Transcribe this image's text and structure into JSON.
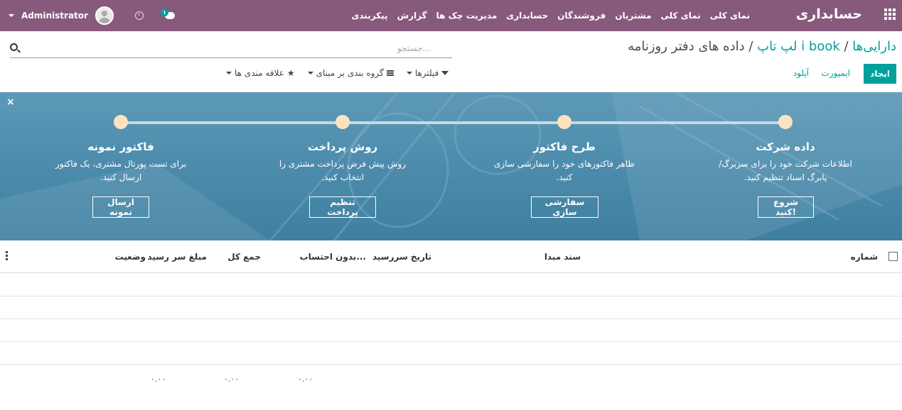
{
  "navbar": {
    "brand": "حسابداری",
    "menu": [
      "نمای کلی",
      "نمای کلی",
      "مشتریان",
      "فروشندگان",
      "حسابداری",
      "مدیریت چک ها",
      "گزارش",
      "پیکربندی"
    ],
    "user": "Administrator",
    "chat_badge": "۱"
  },
  "breadcrumb": {
    "item1": "دارایی‌ها",
    "sep1": " / ",
    "item2": "i book لپ تاپ",
    "sep2": " / ",
    "current": "داده های دفتر روزنامه"
  },
  "search": {
    "placeholder": "جستجو..."
  },
  "buttons": {
    "create": "ایجاد",
    "import": "ایمپورت",
    "upload": "آپلود"
  },
  "searchpanel": {
    "filters": "فیلترها",
    "groupby": "گروه بندی بر مبنای",
    "favorites": "علاقه مندی ها"
  },
  "banner": {
    "close": "×",
    "steps": [
      {
        "title": "داده شرکت",
        "desc": "اطلاعات شرکت خود را برای سربرگ/پابرگ اسناد تنظیم کنید.",
        "button": "شروع کنید!"
      },
      {
        "title": "طرح فاکتور",
        "desc": "ظاهر فاکتورهای خود را سفارشی سازی کنید.",
        "button": "سفارشی سازی"
      },
      {
        "title": "روش پرداخت",
        "desc": "روش پیش فرض پرداخت مشتری را انتخاب کنید.",
        "button": "تنظیم پرداخت"
      },
      {
        "title": "فاکتور نمونه",
        "desc": "برای تست پورتال مشتری، یک فاکتور ارسال کنید.",
        "button": "ارسال نمونه"
      }
    ]
  },
  "table": {
    "columns": [
      "شماره",
      "سند مبدا",
      "تاریخ سررسید",
      "بدون احتساب...",
      "جمع کل",
      "مبلغ سر رسید",
      "وضعیت"
    ],
    "totals": [
      "۰.۰۰",
      "۰.۰۰",
      "۰.۰۰"
    ]
  },
  "colors": {
    "navbar": "#875a7b",
    "accent": "#00a09d",
    "banner": "#4b8aab"
  }
}
